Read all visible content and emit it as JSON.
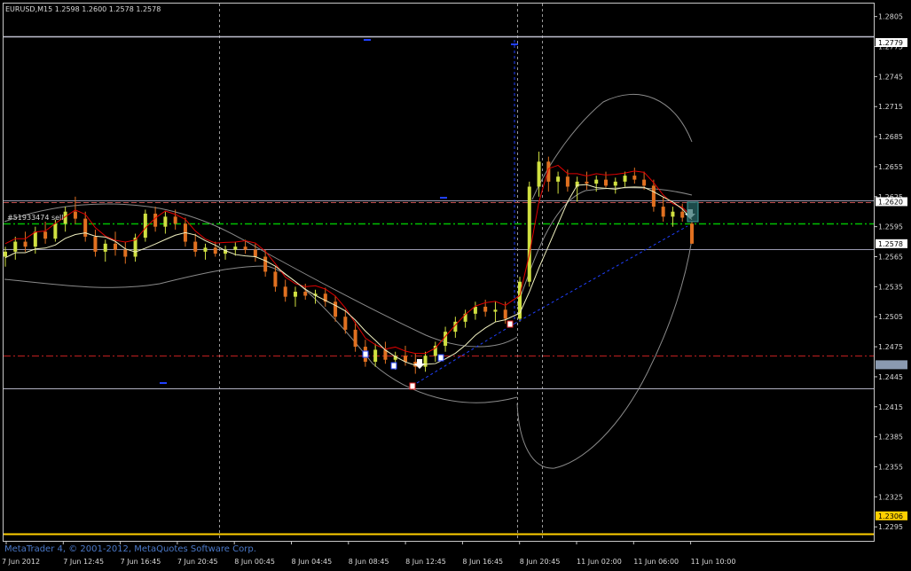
{
  "window": {
    "header": "EURUSD,M15  1.2598 1.2600 1.2578 1.2578",
    "watermark": "MetaTrader 4, © 2001-2012, MetaQuotes Software Corp.",
    "order_label": "#51933474 sell"
  },
  "colors": {
    "background": "#000000",
    "frame": "#c8c8c8",
    "bull_candle": "#d0e040",
    "bear_candle": "#e07020",
    "ma_fast": "#e00000",
    "ma_slow": "#f0f0c0",
    "band": "#9a9a9a",
    "resistance_line": "#c0c0d0",
    "entry_line": "#00c000",
    "stop_line": "#c02020",
    "support_line": "#ffd000",
    "trend_line": "#2040ff"
  },
  "chart_data": {
    "type": "candlestick",
    "symbol": "EURUSD",
    "timeframe": "M15",
    "ohlc_last": {
      "open": 1.2598,
      "high": 1.26,
      "low": 1.2578,
      "close": 1.2578
    },
    "ylim": [
      1.2281,
      1.2818
    ],
    "y_ticks": [
      "1.2805",
      "1.2775",
      "1.2745",
      "1.2715",
      "1.2685",
      "1.2655",
      "1.2625",
      "1.2595",
      "1.2565",
      "1.2535",
      "1.2505",
      "1.2475",
      "1.2445",
      "1.2415",
      "1.2385",
      "1.2355",
      "1.2325",
      "1.2295"
    ],
    "x_ticks": [
      "7 Jun 2012",
      "7 Jun 12:45",
      "7 Jun 16:45",
      "7 Jun 20:45",
      "8 Jun 00:45",
      "8 Jun 04:45",
      "8 Jun 08:45",
      "8 Jun 12:45",
      "8 Jun 16:45",
      "8 Jun 20:45",
      "11 Jun 02:00",
      "11 Jun 06:00",
      "11 Jun 10:00"
    ],
    "price_labels": [
      {
        "text": "1.2779",
        "value": 1.2779
      },
      {
        "text": "1.2620",
        "value": 1.262
      },
      {
        "text": "1.2578",
        "value": 1.2578
      },
      {
        "text": "",
        "value": 1.2457
      },
      {
        "text": "1.2306",
        "value": 1.2306
      }
    ],
    "horizontal_lines": [
      {
        "name": "resistance",
        "value": 1.2779,
        "style": "solid"
      },
      {
        "name": "order-level",
        "value": 1.2622,
        "style": "dashed"
      },
      {
        "name": "entry",
        "value": 1.26,
        "style": "dashdot"
      },
      {
        "name": "bid",
        "value": 1.2578,
        "style": "solid"
      },
      {
        "name": "stop",
        "value": 1.2474,
        "style": "dashdot"
      },
      {
        "name": "low-level",
        "value": 1.2457,
        "style": "solid"
      },
      {
        "name": "support",
        "value": 1.2306,
        "style": "solid"
      }
    ],
    "vertical_separators": [
      "7 Jun 20:45",
      "8 Jun 20:45",
      "11 Jun 06:00"
    ],
    "candles": [
      [
        1.2565,
        1.2575,
        1.2555,
        1.257
      ],
      [
        1.257,
        1.2585,
        1.2562,
        1.258
      ],
      [
        1.258,
        1.259,
        1.257,
        1.2575
      ],
      [
        1.2575,
        1.2595,
        1.2568,
        1.259
      ],
      [
        1.259,
        1.26,
        1.2578,
        1.2583
      ],
      [
        1.2583,
        1.2602,
        1.258,
        1.2598
      ],
      [
        1.2598,
        1.2615,
        1.259,
        1.261
      ],
      [
        1.261,
        1.2625,
        1.2598,
        1.2603
      ],
      [
        1.2603,
        1.261,
        1.258,
        1.2585
      ],
      [
        1.2585,
        1.2592,
        1.2565,
        1.257
      ],
      [
        1.257,
        1.2582,
        1.256,
        1.2578
      ],
      [
        1.2578,
        1.259,
        1.2566,
        1.2572
      ],
      [
        1.2572,
        1.258,
        1.2558,
        1.2565
      ],
      [
        1.2565,
        1.2588,
        1.256,
        1.2584
      ],
      [
        1.2584,
        1.2612,
        1.258,
        1.2608
      ],
      [
        1.2608,
        1.2615,
        1.259,
        1.2595
      ],
      [
        1.2595,
        1.261,
        1.2588,
        1.2605
      ],
      [
        1.2605,
        1.2612,
        1.2592,
        1.2598
      ],
      [
        1.2598,
        1.2604,
        1.2575,
        1.258
      ],
      [
        1.258,
        1.2588,
        1.2565,
        1.257
      ],
      [
        1.257,
        1.2578,
        1.2562,
        1.2574
      ],
      [
        1.2574,
        1.258,
        1.2565,
        1.2568
      ],
      [
        1.2568,
        1.2576,
        1.2562,
        1.2572
      ],
      [
        1.2572,
        1.258,
        1.2566,
        1.2575
      ],
      [
        1.2575,
        1.2582,
        1.2568,
        1.2572
      ],
      [
        1.2572,
        1.2578,
        1.256,
        1.2565
      ],
      [
        1.2565,
        1.2572,
        1.2545,
        1.255
      ],
      [
        1.255,
        1.2555,
        1.253,
        1.2535
      ],
      [
        1.2535,
        1.2542,
        1.252,
        1.2525
      ],
      [
        1.2525,
        1.2535,
        1.2515,
        1.253
      ],
      [
        1.253,
        1.2538,
        1.2522,
        1.2526
      ],
      [
        1.2526,
        1.2532,
        1.2518,
        1.2528
      ],
      [
        1.2528,
        1.2534,
        1.2515,
        1.252
      ],
      [
        1.252,
        1.2526,
        1.25,
        1.2505
      ],
      [
        1.2505,
        1.2512,
        1.2488,
        1.2492
      ],
      [
        1.2492,
        1.25,
        1.247,
        1.2475
      ],
      [
        1.2475,
        1.2482,
        1.2455,
        1.246
      ],
      [
        1.246,
        1.2478,
        1.2455,
        1.2472
      ],
      [
        1.2472,
        1.248,
        1.2458,
        1.2462
      ],
      [
        1.2462,
        1.247,
        1.2452,
        1.2466
      ],
      [
        1.2466,
        1.2476,
        1.2456,
        1.246
      ],
      [
        1.246,
        1.2468,
        1.2448,
        1.2455
      ],
      [
        1.2455,
        1.247,
        1.245,
        1.2466
      ],
      [
        1.2466,
        1.248,
        1.246,
        1.2476
      ],
      [
        1.2476,
        1.2495,
        1.247,
        1.249
      ],
      [
        1.249,
        1.2505,
        1.2484,
        1.25
      ],
      [
        1.25,
        1.2512,
        1.2494,
        1.2508
      ],
      [
        1.2508,
        1.252,
        1.2502,
        1.2515
      ],
      [
        1.2515,
        1.2522,
        1.2505,
        1.251
      ],
      [
        1.251,
        1.252,
        1.25,
        1.2512
      ],
      [
        1.2512,
        1.252,
        1.2498,
        1.2503
      ],
      [
        1.2503,
        1.2545,
        1.25,
        1.254
      ],
      [
        1.254,
        1.264,
        1.2535,
        1.2635
      ],
      [
        1.2635,
        1.267,
        1.2625,
        1.266
      ],
      [
        1.266,
        1.2665,
        1.263,
        1.264
      ],
      [
        1.264,
        1.265,
        1.2628,
        1.2645
      ],
      [
        1.2645,
        1.2652,
        1.263,
        1.2635
      ],
      [
        1.2635,
        1.2645,
        1.262,
        1.264
      ],
      [
        1.264,
        1.265,
        1.2632,
        1.2638
      ],
      [
        1.2638,
        1.2646,
        1.263,
        1.2642
      ],
      [
        1.2642,
        1.265,
        1.2634,
        1.2636
      ],
      [
        1.2636,
        1.2644,
        1.2628,
        1.264
      ],
      [
        1.264,
        1.265,
        1.2635,
        1.2646
      ],
      [
        1.2646,
        1.2654,
        1.2638,
        1.2642
      ],
      [
        1.2642,
        1.265,
        1.2632,
        1.2636
      ],
      [
        1.2636,
        1.2642,
        1.261,
        1.2615
      ],
      [
        1.2615,
        1.2625,
        1.26,
        1.2605
      ],
      [
        1.2605,
        1.2615,
        1.2595,
        1.261
      ],
      [
        1.261,
        1.2618,
        1.26,
        1.2604
      ],
      [
        1.2598,
        1.26,
        1.2578,
        1.2578
      ]
    ]
  }
}
